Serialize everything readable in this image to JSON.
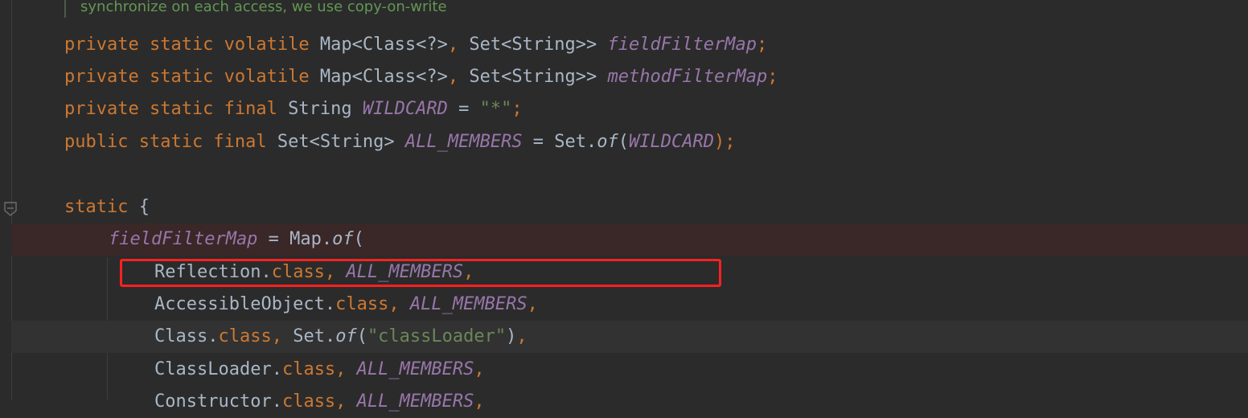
{
  "comment": {
    "text": "synchronize on each access, we use copy-on-write"
  },
  "lines": [
    {
      "id": "l1",
      "tokens": [
        {
          "t": "private static volatile ",
          "c": "kw"
        },
        {
          "t": "Map<Class<?>",
          "c": "plain"
        },
        {
          "t": ", ",
          "c": "kw"
        },
        {
          "t": "Set<String>> ",
          "c": "plain"
        },
        {
          "t": "fieldFilterMap",
          "c": "fld"
        },
        {
          "t": ";",
          "c": "kw"
        }
      ]
    },
    {
      "id": "l2",
      "tokens": [
        {
          "t": "private static volatile ",
          "c": "kw"
        },
        {
          "t": "Map<Class<?>",
          "c": "plain"
        },
        {
          "t": ", ",
          "c": "kw"
        },
        {
          "t": "Set<String>> ",
          "c": "plain"
        },
        {
          "t": "methodFilterMap",
          "c": "fld"
        },
        {
          "t": ";",
          "c": "kw"
        }
      ]
    },
    {
      "id": "l3",
      "tokens": [
        {
          "t": "private static final ",
          "c": "kw"
        },
        {
          "t": "String ",
          "c": "plain"
        },
        {
          "t": "WILDCARD",
          "c": "cst"
        },
        {
          "t": " = ",
          "c": "plain"
        },
        {
          "t": "\"*\"",
          "c": "str"
        },
        {
          "t": ";",
          "c": "kw"
        }
      ]
    },
    {
      "id": "l4",
      "tokens": [
        {
          "t": "public static final ",
          "c": "kw"
        },
        {
          "t": "Set<String> ",
          "c": "plain"
        },
        {
          "t": "ALL_MEMBERS",
          "c": "cst"
        },
        {
          "t": " = Set.",
          "c": "plain"
        },
        {
          "t": "of",
          "c": "mth"
        },
        {
          "t": "(",
          "c": "plain"
        },
        {
          "t": "WILDCARD",
          "c": "cst"
        },
        {
          "t": ");",
          "c": "kw"
        }
      ]
    },
    {
      "id": "l5",
      "tokens": []
    },
    {
      "id": "l6",
      "tokens": [
        {
          "t": "static ",
          "c": "kw"
        },
        {
          "t": "{",
          "c": "plain"
        }
      ]
    },
    {
      "id": "l7",
      "tokens": [
        {
          "t": "fieldFilterMap",
          "c": "fld"
        },
        {
          "t": " = Map.",
          "c": "plain"
        },
        {
          "t": "of",
          "c": "mth"
        },
        {
          "t": "(",
          "c": "plain"
        }
      ]
    },
    {
      "id": "l8",
      "tokens": [
        {
          "t": "Reflection.",
          "c": "plain"
        },
        {
          "t": "class, ",
          "c": "kw"
        },
        {
          "t": "ALL_MEMBERS",
          "c": "cst"
        },
        {
          "t": ",",
          "c": "kw"
        }
      ]
    },
    {
      "id": "l9",
      "tokens": [
        {
          "t": "AccessibleObject.",
          "c": "plain"
        },
        {
          "t": "class, ",
          "c": "kw"
        },
        {
          "t": "ALL_MEMBERS",
          "c": "cst"
        },
        {
          "t": ",",
          "c": "kw"
        }
      ]
    },
    {
      "id": "l10",
      "tokens": [
        {
          "t": "Class.",
          "c": "plain"
        },
        {
          "t": "class, ",
          "c": "kw"
        },
        {
          "t": "Set.",
          "c": "plain"
        },
        {
          "t": "of",
          "c": "mth"
        },
        {
          "t": "(",
          "c": "plain"
        },
        {
          "t": "\"classLoader\"",
          "c": "str"
        },
        {
          "t": ")",
          "c": "plain"
        },
        {
          "t": ",",
          "c": "kw"
        }
      ]
    },
    {
      "id": "l11",
      "tokens": [
        {
          "t": "ClassLoader.",
          "c": "plain"
        },
        {
          "t": "class, ",
          "c": "kw"
        },
        {
          "t": "ALL_MEMBERS",
          "c": "cst"
        },
        {
          "t": ",",
          "c": "kw"
        }
      ]
    },
    {
      "id": "l12",
      "tokens": [
        {
          "t": "Constructor.",
          "c": "plain"
        },
        {
          "t": "class, ",
          "c": "kw"
        },
        {
          "t": "ALL_MEMBERS",
          "c": "cst"
        },
        {
          "t": ",",
          "c": "kw"
        }
      ]
    }
  ],
  "colors": {
    "background": "#2b2b2b",
    "keyword": "#cc7832",
    "field": "#9876aa",
    "string": "#6a8759",
    "plain": "#a9b7c6",
    "comment": "#629755",
    "error_line": "#3a2727",
    "annotation_box": "#ff2020"
  },
  "icons": {
    "fold": "fold-marker-icon"
  }
}
